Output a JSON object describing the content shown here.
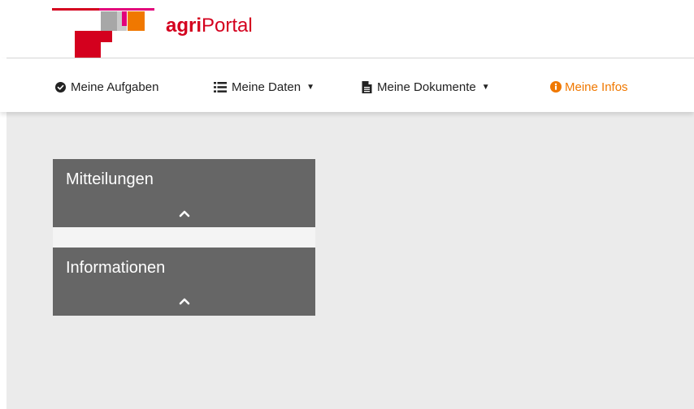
{
  "brand": {
    "name_bold": "agri",
    "name_regular": "Portal",
    "colors": {
      "red": "#d4001e",
      "orange": "#f07800",
      "magenta": "#e2007a",
      "gray": "#a7a7a7"
    }
  },
  "nav": {
    "items": [
      {
        "label": "Meine Aufgaben",
        "icon": "check-circle-icon",
        "dropdown": false,
        "active": false
      },
      {
        "label": "Meine Daten",
        "icon": "list-icon",
        "dropdown": true,
        "active": false
      },
      {
        "label": "Meine Dokumente",
        "icon": "document-icon",
        "dropdown": true,
        "active": false
      },
      {
        "label": "Meine Infos",
        "icon": "info-circle-icon",
        "dropdown": false,
        "active": true
      }
    ],
    "active_color": "#f07800"
  },
  "panels": [
    {
      "title": "Mitteilungen",
      "toggle_icon": "chevron-up-icon",
      "expanded": true
    },
    {
      "title": "Informationen",
      "toggle_icon": "chevron-up-icon",
      "expanded": true
    }
  ]
}
